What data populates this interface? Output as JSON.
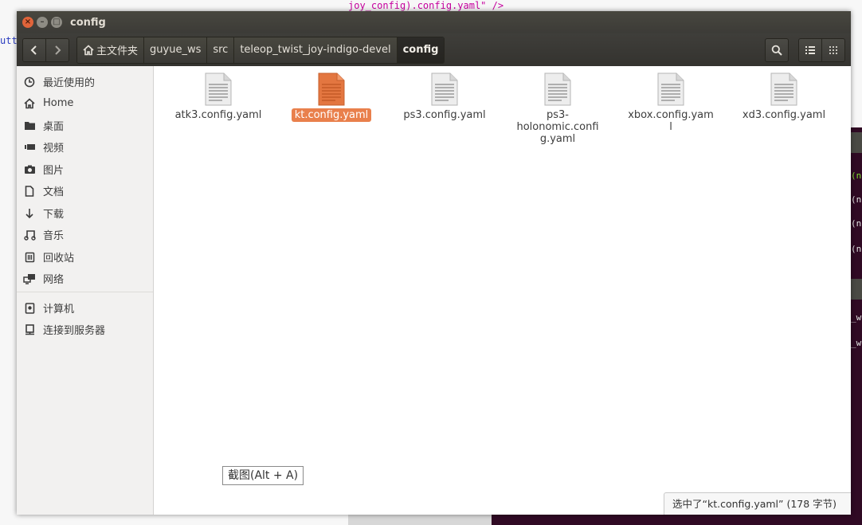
{
  "background": {
    "editor_fragment": "joy_config).config.yaml\" />",
    "left_fragment": "utt",
    "terminal_fragments": [
      "(n",
      "(n",
      "(n",
      "(n",
      "_w",
      "_w"
    ]
  },
  "window": {
    "title": "config",
    "controls": {
      "close": "×",
      "minimize": "–",
      "maximize": "□"
    }
  },
  "toolbar": {
    "back_icon": "chevron-left-icon",
    "forward_icon": "chevron-right-icon",
    "breadcrumbs": [
      {
        "label": "主文件夹",
        "icon": "home-icon"
      },
      {
        "label": "guyue_ws"
      },
      {
        "label": "src"
      },
      {
        "label": "teleop_twist_joy-indigo-devel"
      },
      {
        "label": "config",
        "active": true
      }
    ],
    "search_icon": "search-icon",
    "list_view_icon": "list-view-icon",
    "grid_view_icon": "grid-view-icon"
  },
  "sidebar": {
    "items": [
      {
        "label": "最近使用的",
        "icon": "clock-icon"
      },
      {
        "label": "Home",
        "icon": "home-icon"
      },
      {
        "label": "桌面",
        "icon": "folder-icon"
      },
      {
        "label": "视频",
        "icon": "video-icon"
      },
      {
        "label": "图片",
        "icon": "camera-icon"
      },
      {
        "label": "文档",
        "icon": "document-icon"
      },
      {
        "label": "下载",
        "icon": "download-icon"
      },
      {
        "label": "音乐",
        "icon": "music-icon"
      },
      {
        "label": "回收站",
        "icon": "trash-icon"
      },
      {
        "label": "网络",
        "icon": "network-icon"
      },
      {
        "label": "计算机",
        "icon": "drive-icon"
      },
      {
        "label": "连接到服务器",
        "icon": "server-icon"
      }
    ]
  },
  "files": [
    {
      "name": "atk3.config.yaml",
      "selected": false
    },
    {
      "name": "kt.config.yaml",
      "selected": true
    },
    {
      "name": "ps3.config.yaml",
      "selected": false
    },
    {
      "name": "ps3-holonomic.config.yaml",
      "selected": false
    },
    {
      "name": "xbox.config.yaml",
      "selected": false
    },
    {
      "name": "xd3.config.yaml",
      "selected": false
    }
  ],
  "tooltip": "截图(Alt + A)",
  "status": "选中了“kt.config.yaml” (178 字节)",
  "colors": {
    "selection": "#e9804c",
    "titlebar": "#3c3b37",
    "close_button": "#e0643a",
    "terminal": "#300a24"
  }
}
